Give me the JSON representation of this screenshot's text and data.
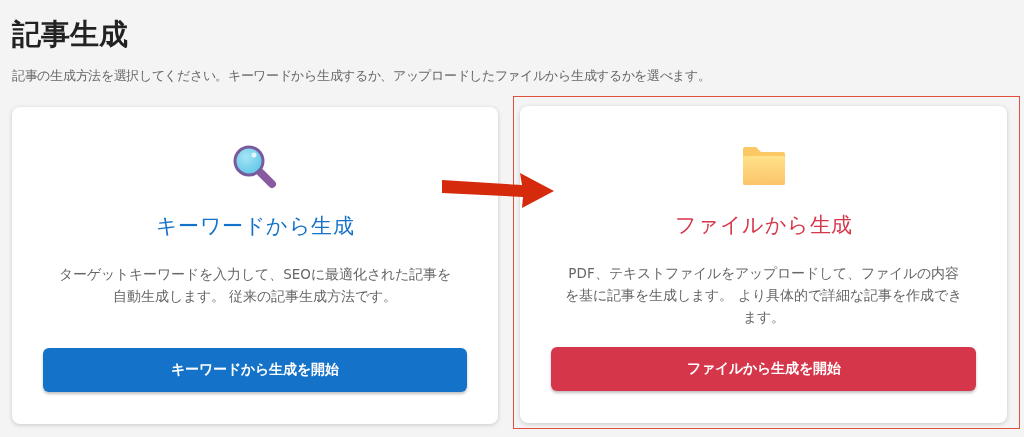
{
  "page": {
    "title": "記事生成",
    "subtitle": "記事の生成方法を選択してください。キーワードから生成するか、アップロードしたファイルから生成するかを選べます。"
  },
  "options": [
    {
      "kind": "keyword",
      "title": "キーワードから生成",
      "description": "ターゲットキーワードを入力して、SEOに最適化された記事を自動生成します。 従来の記事生成方法です。",
      "button": "キーワードから生成を開始",
      "color": "#1572c9",
      "highlighted": false
    },
    {
      "kind": "file",
      "title": "ファイルから生成",
      "description": "PDF、テキストファイルをアップロードして、ファイルの内容を基に記事を生成します。 より具体的で詳細な記事を作成できます。",
      "button": "ファイルから生成を開始",
      "color": "#d6364a",
      "highlighted": true
    }
  ],
  "annotation": {
    "arrow": true
  }
}
